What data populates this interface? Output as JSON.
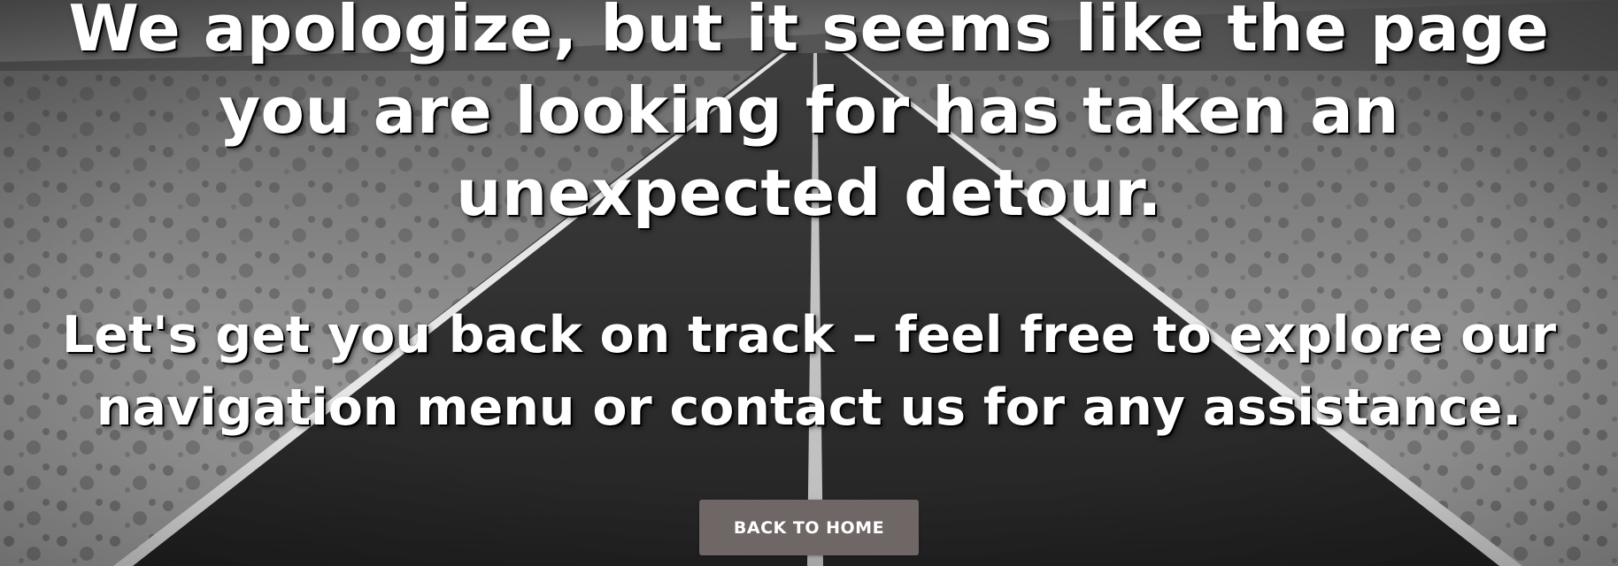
{
  "hero": {
    "headline": "We apologize, but it seems like the page you are looking for has taken an unexpected detour.",
    "subline": "Let's get you back on track – feel free to explore our navigation menu or contact us for any assistance.",
    "button_label": "BACK TO HOME"
  },
  "colors": {
    "text": "#ffffff",
    "button_bg": "#6e6766",
    "asphalt": "#2b2b2b",
    "desert": "#8a8a8a"
  }
}
